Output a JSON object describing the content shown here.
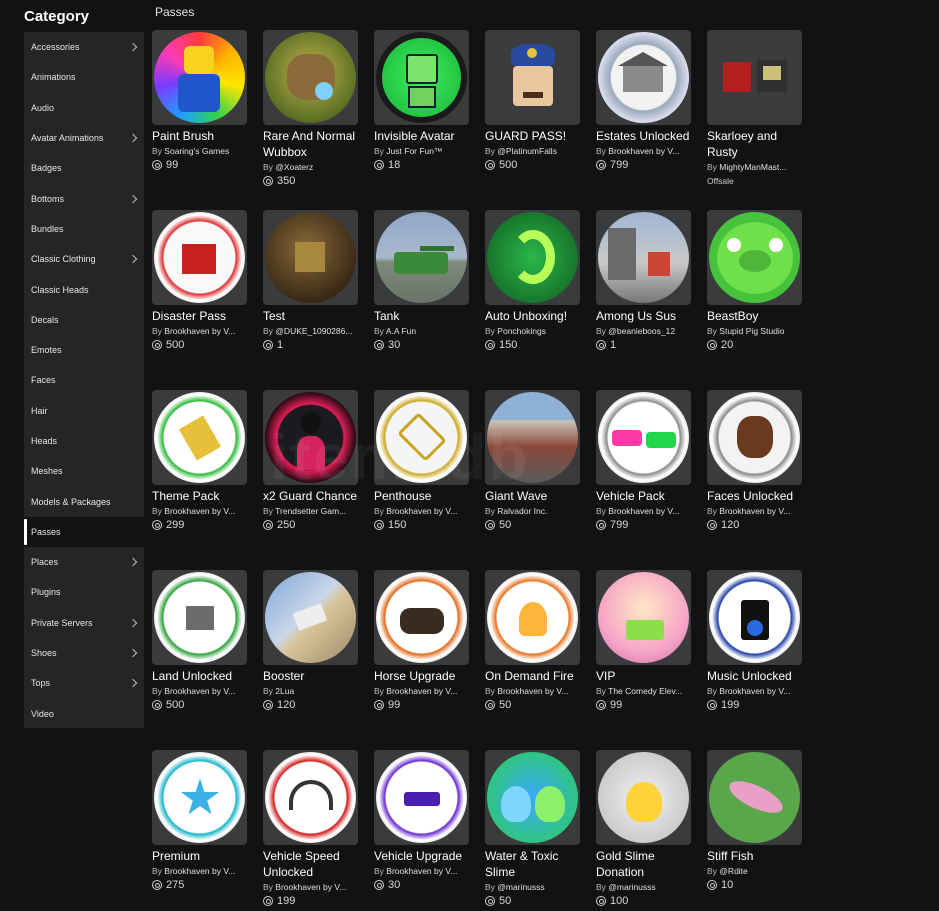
{
  "sidebar": {
    "title": "Category",
    "items": [
      {
        "label": "Accessories",
        "chevron": true
      },
      {
        "label": "Animations",
        "chevron": false
      },
      {
        "label": "Audio",
        "chevron": false
      },
      {
        "label": "Avatar Animations",
        "chevron": true
      },
      {
        "label": "Badges",
        "chevron": false
      },
      {
        "label": "Bottoms",
        "chevron": true
      },
      {
        "label": "Bundles",
        "chevron": false
      },
      {
        "label": "Classic Clothing",
        "chevron": true
      },
      {
        "label": "Classic Heads",
        "chevron": false
      },
      {
        "label": "Decals",
        "chevron": false
      },
      {
        "label": "Emotes",
        "chevron": false
      },
      {
        "label": "Faces",
        "chevron": false
      },
      {
        "label": "Hair",
        "chevron": false
      },
      {
        "label": "Heads",
        "chevron": false
      },
      {
        "label": "Meshes",
        "chevron": false
      },
      {
        "label": "Models & Packages",
        "chevron": false
      },
      {
        "label": "Passes",
        "chevron": false,
        "active": true
      },
      {
        "label": "Places",
        "chevron": true
      },
      {
        "label": "Plugins",
        "chevron": false
      },
      {
        "label": "Private Servers",
        "chevron": true
      },
      {
        "label": "Shoes",
        "chevron": true
      },
      {
        "label": "Tops",
        "chevron": true
      },
      {
        "label": "Video",
        "chevron": false
      }
    ]
  },
  "section_title": "Passes",
  "by_label": "By",
  "watermark": "itemsdb",
  "items": [
    {
      "name": "Paint Brush",
      "creator": "Soaring's Games",
      "price": "99",
      "icon": "paint-brush-thumbnail"
    },
    {
      "name": "Rare And Normal Wubbox",
      "creator": "@Xoaterz",
      "price": "350",
      "icon": "wubbox-thumbnail"
    },
    {
      "name": "Invisible Avatar",
      "creator": "Just For Fun™",
      "price": "18",
      "icon": "invisible-avatar-thumbnail"
    },
    {
      "name": "GUARD PASS!",
      "creator": "@PlatinumFalls",
      "price": "500",
      "icon": "guard-thumbnail"
    },
    {
      "name": "Estates Unlocked",
      "creator": "Brookhaven by V...",
      "price": "799",
      "icon": "estates-thumbnail"
    },
    {
      "name": "Skarloey and Rusty",
      "creator": "MightyManMast...",
      "price": "",
      "offsale": "Offsale",
      "icon": "trains-thumbnail"
    },
    {
      "name": "Disaster Pass",
      "creator": "Brookhaven by V...",
      "price": "500",
      "icon": "disaster-thumbnail"
    },
    {
      "name": "Test",
      "creator": "@DUKE_1090286...",
      "price": "1",
      "icon": "test-thumbnail"
    },
    {
      "name": "Tank",
      "creator": "A.A Fun",
      "price": "30",
      "icon": "tank-thumbnail"
    },
    {
      "name": "Auto Unboxing!",
      "creator": "Ponchokings",
      "price": "150",
      "icon": "auto-unboxing-thumbnail"
    },
    {
      "name": "Among Us Sus",
      "creator": "@beanieboos_12",
      "price": "1",
      "icon": "among-us-thumbnail"
    },
    {
      "name": "BeastBoy",
      "creator": "Stupid Pig Studio",
      "price": "20",
      "icon": "pig-thumbnail"
    },
    {
      "name": "Theme Pack",
      "creator": "Brookhaven by V...",
      "price": "299",
      "icon": "theme-pack-thumbnail"
    },
    {
      "name": "x2 Guard Chance",
      "creator": "Trendsetter Gam...",
      "price": "250",
      "icon": "guard-chance-thumbnail"
    },
    {
      "name": "Penthouse",
      "creator": "Brookhaven by V...",
      "price": "150",
      "icon": "diamond-thumbnail"
    },
    {
      "name": "Giant Wave",
      "creator": "Ralvador Inc.",
      "price": "50",
      "icon": "giant-wave-thumbnail"
    },
    {
      "name": "Vehicle Pack",
      "creator": "Brookhaven by V...",
      "price": "799",
      "icon": "vehicle-pack-thumbnail"
    },
    {
      "name": "Faces Unlocked",
      "creator": "Brookhaven by V...",
      "price": "120",
      "icon": "faces-unlocked-thumbnail"
    },
    {
      "name": "Land Unlocked",
      "creator": "Brookhaven by V...",
      "price": "500",
      "icon": "land-unlocked-thumbnail"
    },
    {
      "name": "Booster",
      "creator": "2Lua",
      "price": "120",
      "icon": "booster-thumbnail"
    },
    {
      "name": "Horse Upgrade",
      "creator": "Brookhaven by V...",
      "price": "99",
      "icon": "horse-upgrade-thumbnail"
    },
    {
      "name": "On Demand Fire",
      "creator": "Brookhaven by V...",
      "price": "50",
      "icon": "demand-fire-thumbnail"
    },
    {
      "name": "VIP",
      "creator": "The Comedy Elev...",
      "price": "99",
      "icon": "vip-thumbnail"
    },
    {
      "name": "Music Unlocked",
      "creator": "Brookhaven by V...",
      "price": "199",
      "icon": "music-unlocked-thumbnail"
    },
    {
      "name": "Premium",
      "creator": "Brookhaven by V...",
      "price": "275",
      "icon": "premium-star-thumbnail"
    },
    {
      "name": "Vehicle Speed Unlocked",
      "creator": "Brookhaven by V...",
      "price": "199",
      "icon": "speedometer-thumbnail"
    },
    {
      "name": "Vehicle Upgrade",
      "creator": "Brookhaven by V...",
      "price": "30",
      "icon": "vehicle-upgrade-thumbnail"
    },
    {
      "name": "Water & Toxic Slime",
      "creator": "@marinusss",
      "price": "50",
      "icon": "slime-thumbnail"
    },
    {
      "name": "Gold Slime Donation",
      "creator": "@marinusss",
      "price": "100",
      "icon": "gold-slime-thumbnail"
    },
    {
      "name": "Stiff Fish",
      "creator": "@Rdite",
      "price": "10",
      "icon": "fish-thumbnail"
    }
  ]
}
